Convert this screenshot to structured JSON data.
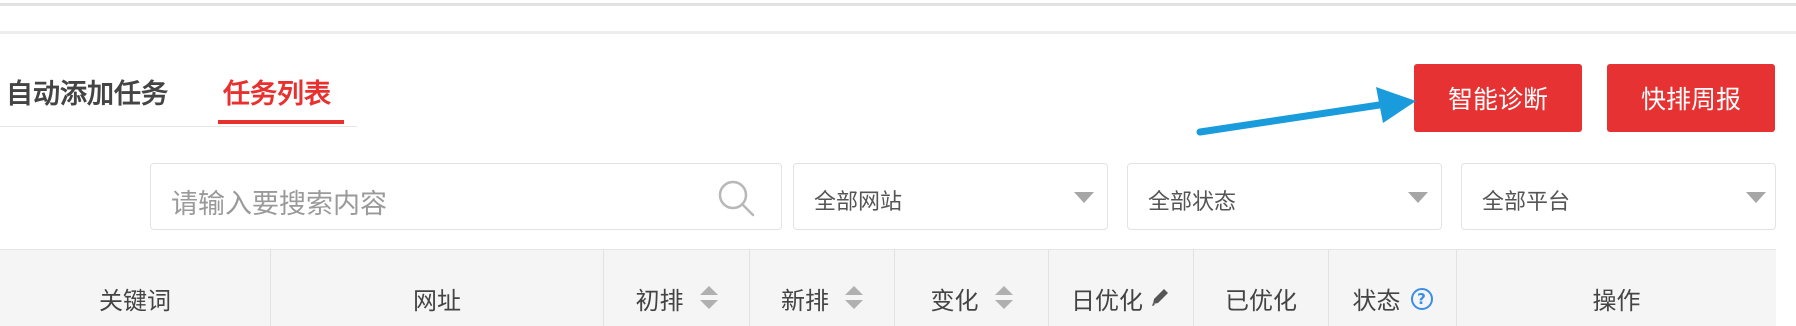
{
  "tabs": [
    {
      "label": "自动添加任务",
      "active": false
    },
    {
      "label": "任务列表",
      "active": true
    }
  ],
  "buttons": {
    "diagnose": "智能诊断",
    "weekly_report": "快排周报"
  },
  "search": {
    "placeholder": "请输入要搜索内容"
  },
  "filters": {
    "site": "全部网站",
    "status": "全部状态",
    "platform": "全部平台"
  },
  "table": {
    "headers": {
      "keyword": "关键词",
      "url": "网址",
      "initial_rank": "初排",
      "new_rank": "新排",
      "change": "变化",
      "daily_optimize": "日优化",
      "optimized": "已优化",
      "status": "状态",
      "actions": "操作"
    }
  },
  "colors": {
    "accent": "#e63232",
    "tab_active": "#e8312f",
    "arrow": "#1a9bdb",
    "help": "#3a8ee6"
  },
  "icons": {
    "search": "search-icon",
    "sort": "sort-icon",
    "edit": "pencil-icon",
    "help": "help-icon",
    "dropdown": "caret-down-icon"
  }
}
